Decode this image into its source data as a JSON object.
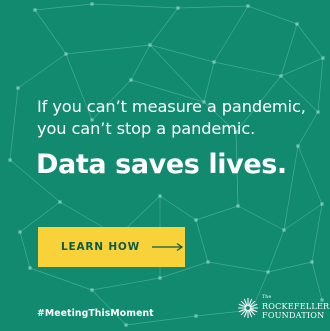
{
  "colors": {
    "background": "#118a6f",
    "line": "#6bc9b4",
    "node": "#8ad8c5",
    "cta_background": "#f7d339",
    "cta_text": "#0d5a49",
    "text": "#ffffff"
  },
  "tagline": "If you can’t measure a pandemic, you can’t stop a pandemic.",
  "headline": "Data saves lives.",
  "cta": {
    "label": "LEARN HOW",
    "icon": "long-arrow-right-icon"
  },
  "hashtag": "#MeetingThisMoment",
  "logo": {
    "the": "The",
    "line1": "ROCKEFELLER",
    "line2": "FOUNDATION",
    "icon": "starburst-logo-icon"
  }
}
